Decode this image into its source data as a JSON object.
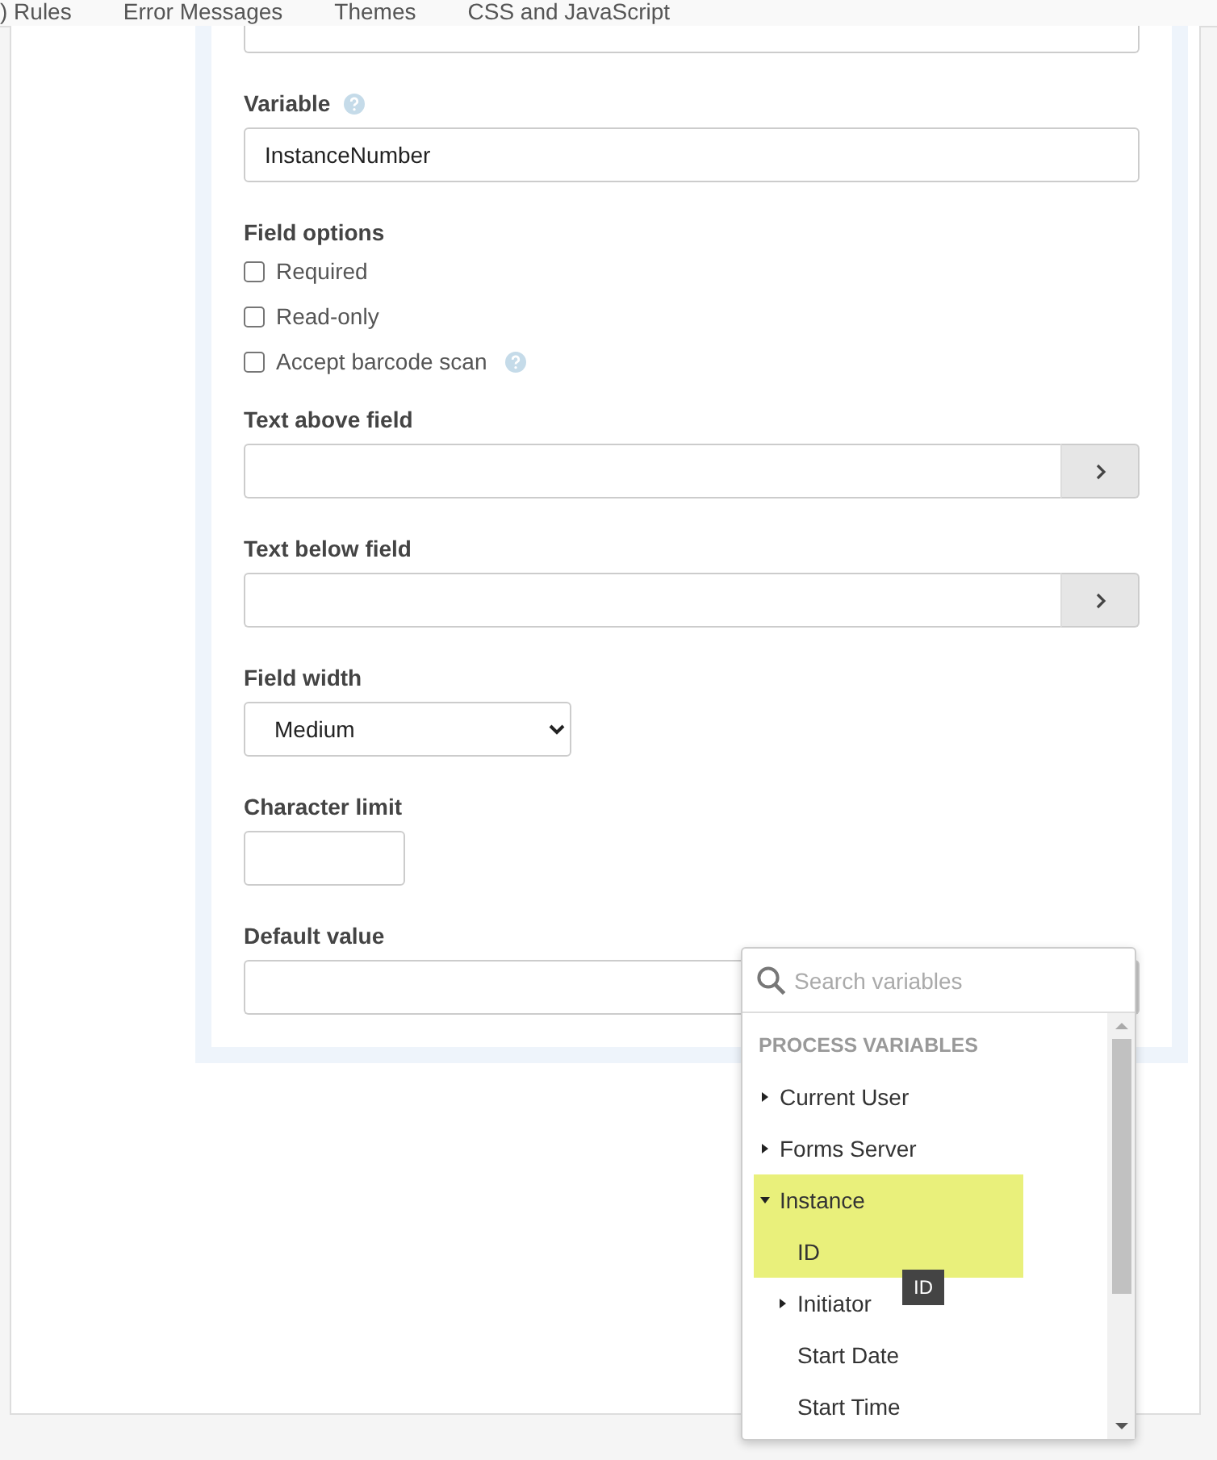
{
  "tabs": [
    {
      "label": ") Rules",
      "selected": false
    },
    {
      "label": "Error Messages",
      "selected": false
    },
    {
      "label": "Themes",
      "selected": false
    },
    {
      "label": "CSS and JavaScript",
      "selected": false
    }
  ],
  "form": {
    "variable": {
      "label": "Variable",
      "value": "InstanceNumber"
    },
    "field_options": {
      "label": "Field options",
      "options": [
        {
          "label": "Required",
          "checked": false,
          "help": false
        },
        {
          "label": "Read-only",
          "checked": false,
          "help": false
        },
        {
          "label": "Accept barcode scan",
          "checked": false,
          "help": true
        }
      ]
    },
    "text_above_field": {
      "label": "Text above field"
    },
    "text_below_field": {
      "label": "Text below field"
    },
    "field_width": {
      "label": "Field width",
      "value": "Medium"
    },
    "character_limit": {
      "label": "Character limit"
    },
    "default_value": {
      "label": "Default value"
    }
  },
  "variable_picker": {
    "search": {
      "placeholder": "Search variables"
    },
    "heading": "PROCESS VARIABLES",
    "items": [
      {
        "label": "Current User",
        "expanded": false,
        "selected": false
      },
      {
        "label": "Forms Server",
        "expanded": false,
        "selected": false
      },
      {
        "label": "Instance",
        "expanded": true,
        "selected": true,
        "children": [
          {
            "label": "ID",
            "selected": true
          },
          {
            "label": "Initiator",
            "expanded": false,
            "selected": false
          },
          {
            "label": "Start Date",
            "selected": false
          },
          {
            "label": "Start Time",
            "selected": false
          }
        ]
      }
    ],
    "tooltip": "ID"
  }
}
